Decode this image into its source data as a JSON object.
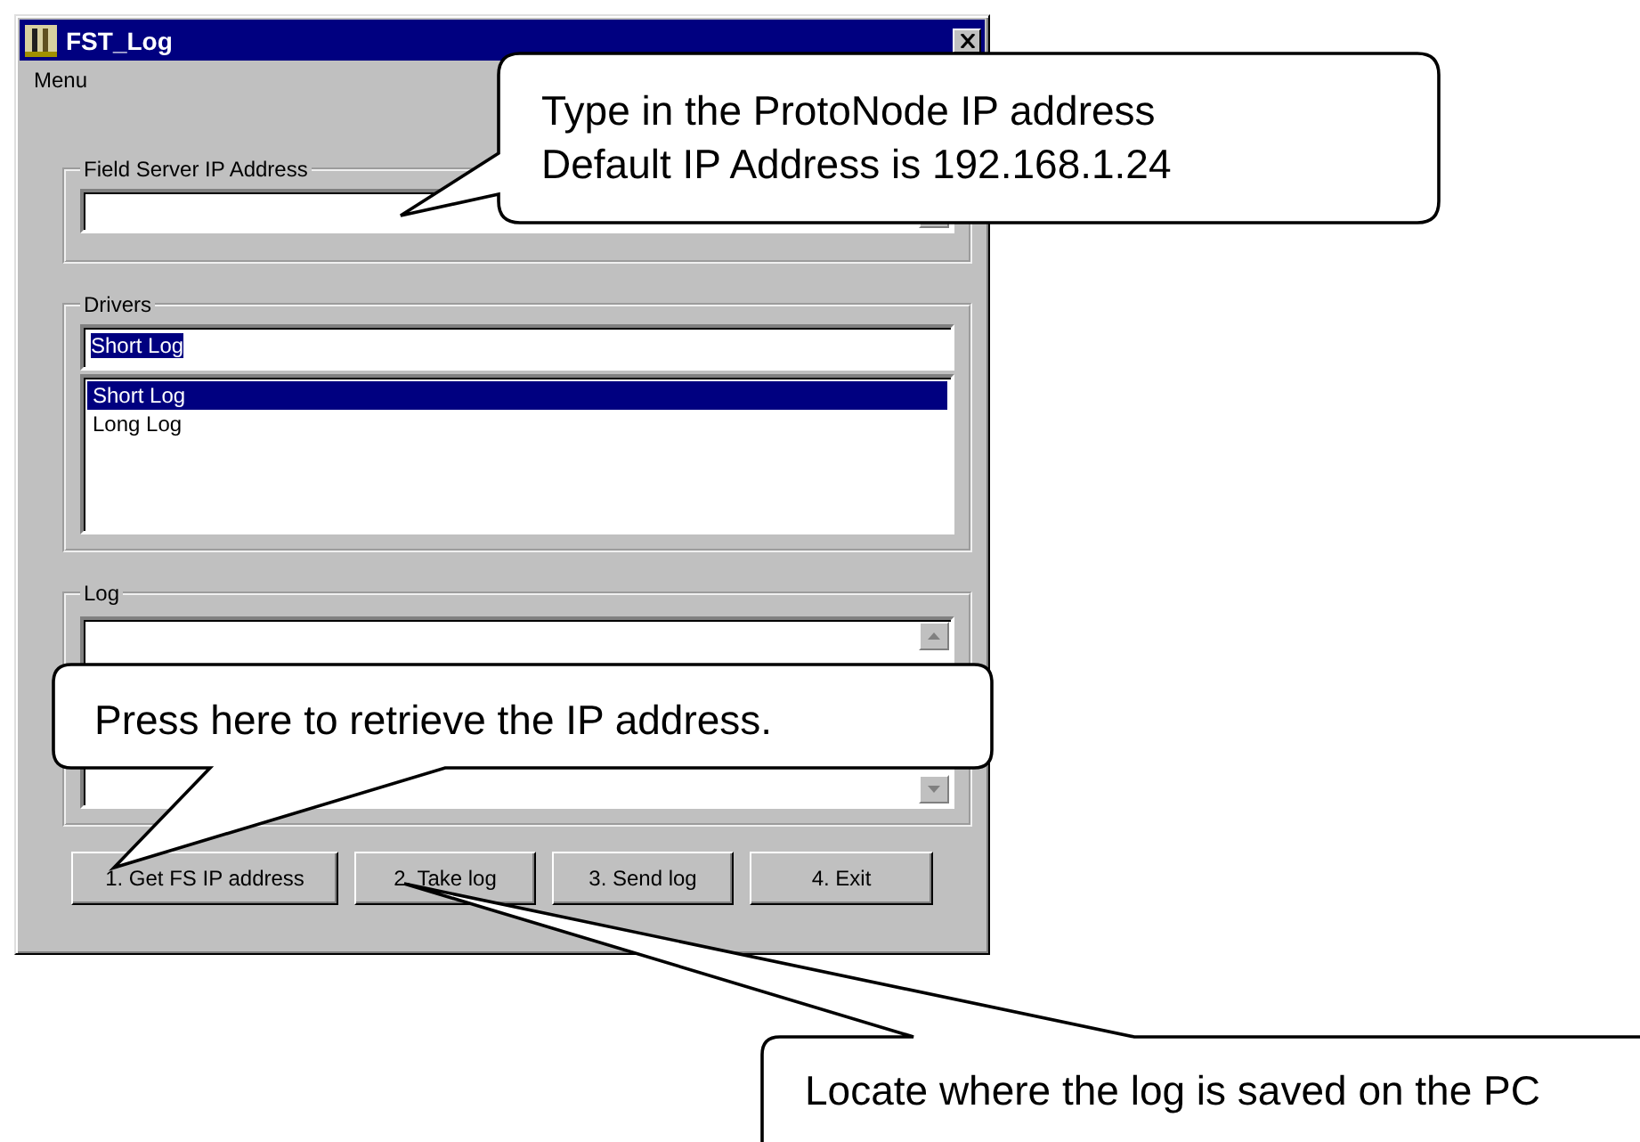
{
  "window": {
    "title": "FST_Log"
  },
  "menu": [
    "Menu"
  ],
  "field_server": {
    "label": "Field Server IP Address"
  },
  "drivers": {
    "label": "Drivers",
    "value": "Short Log",
    "items": [
      {
        "label": "Short Log",
        "selected": true
      },
      {
        "label": "Long Log",
        "selected": false
      }
    ]
  },
  "log": {
    "label": "Log"
  },
  "buttons": [
    "1. Get FS IP address",
    "2. Take log",
    "3. Send log",
    "4. Exit"
  ],
  "callouts": [
    {
      "lines": [
        "Type in the ProtoNode IP address",
        "Default IP Address is 192.168.1.24"
      ]
    },
    {
      "lines": [
        "Press here to retrieve the IP address."
      ]
    },
    {
      "lines": [
        "Locate where the log is saved on the PC"
      ]
    }
  ]
}
